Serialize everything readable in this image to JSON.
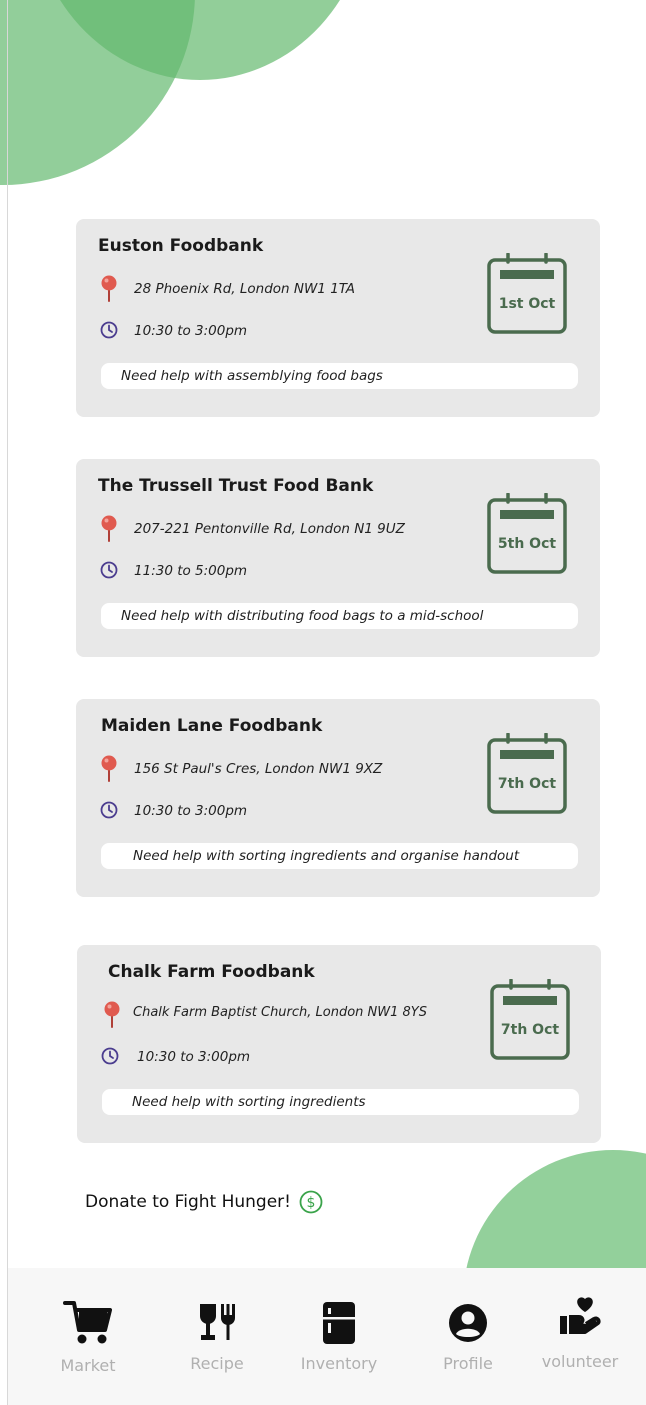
{
  "events": [
    {
      "title": "Euston Foodbank",
      "address": "28 Phoenix Rd, London NW1 1TA",
      "time": "10:30 to 3:00pm",
      "help": "Need help with assemblying food bags",
      "date": "1st Oct"
    },
    {
      "title": "The Trussell Trust Food Bank",
      "address": "207-221 Pentonville Rd, London N1 9UZ",
      "time": "11:30 to 5:00pm",
      "help": "Need help with distributing food bags to a mid-school",
      "date": "5th Oct"
    },
    {
      "title": "Maiden Lane Foodbank",
      "address": "156 St Paul's Cres, London NW1 9XZ",
      "time": "10:30 to 3:00pm",
      "help": "Need help with sorting ingredients and organise handout",
      "date": "7th Oct"
    },
    {
      "title": "Chalk Farm Foodbank",
      "address": "Chalk Farm Baptist Church, London NW1 8YS",
      "time": "10:30 to 3:00pm",
      "help": "Need help with sorting ingredients",
      "date": "7th Oct"
    }
  ],
  "donate": {
    "label": "Donate to Fight Hunger!",
    "icon": "dollar-circle-icon"
  },
  "nav": {
    "market": "Market",
    "recipe": "Recipe",
    "inventory": "Inventory",
    "profile": "Profile",
    "volunteer": "volunteer"
  },
  "colors": {
    "accent_green": "#93d09b",
    "calendar_green": "#4a6b4e",
    "pin_red": "#e05a4f",
    "clock_purple": "#4b3d8f",
    "card_bg": "#e8e8e8"
  }
}
